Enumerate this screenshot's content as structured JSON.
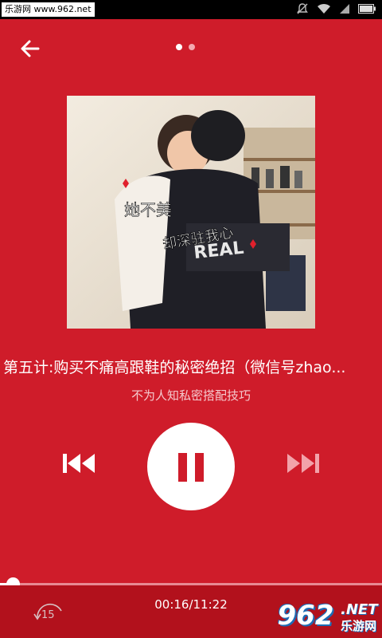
{
  "status_bar": {
    "site_label": "乐游网 www.962.net",
    "icons": [
      "notification-muted-icon",
      "wifi-icon",
      "signal-icon",
      "battery-icon"
    ]
  },
  "header": {
    "back_icon": "arrow-left-icon",
    "pages": {
      "count": 2,
      "active": 0
    }
  },
  "cover": {
    "overlay_text_1": "她不美",
    "overlay_text_2": "却深驻我心"
  },
  "track": {
    "title": "第五计:购买不痛高跟鞋的秘密绝招（微信号zhao...",
    "subtitle": "不为人知私密搭配技巧"
  },
  "controls": {
    "prev_icon": "skip-previous-icon",
    "play_state": "pause-icon",
    "next_icon": "skip-next-icon"
  },
  "progress": {
    "fraction": 0.024,
    "time": "00:16/11:22"
  },
  "rewind": {
    "icon": "rewind-15-icon",
    "seconds": "15"
  },
  "watermark": {
    "number": "962",
    "suffix": ".NET",
    "name": "乐游网"
  },
  "colors": {
    "background": "#cf1c2a",
    "bottom_bar": "#b2111c",
    "accent_white": "#ffffff"
  }
}
